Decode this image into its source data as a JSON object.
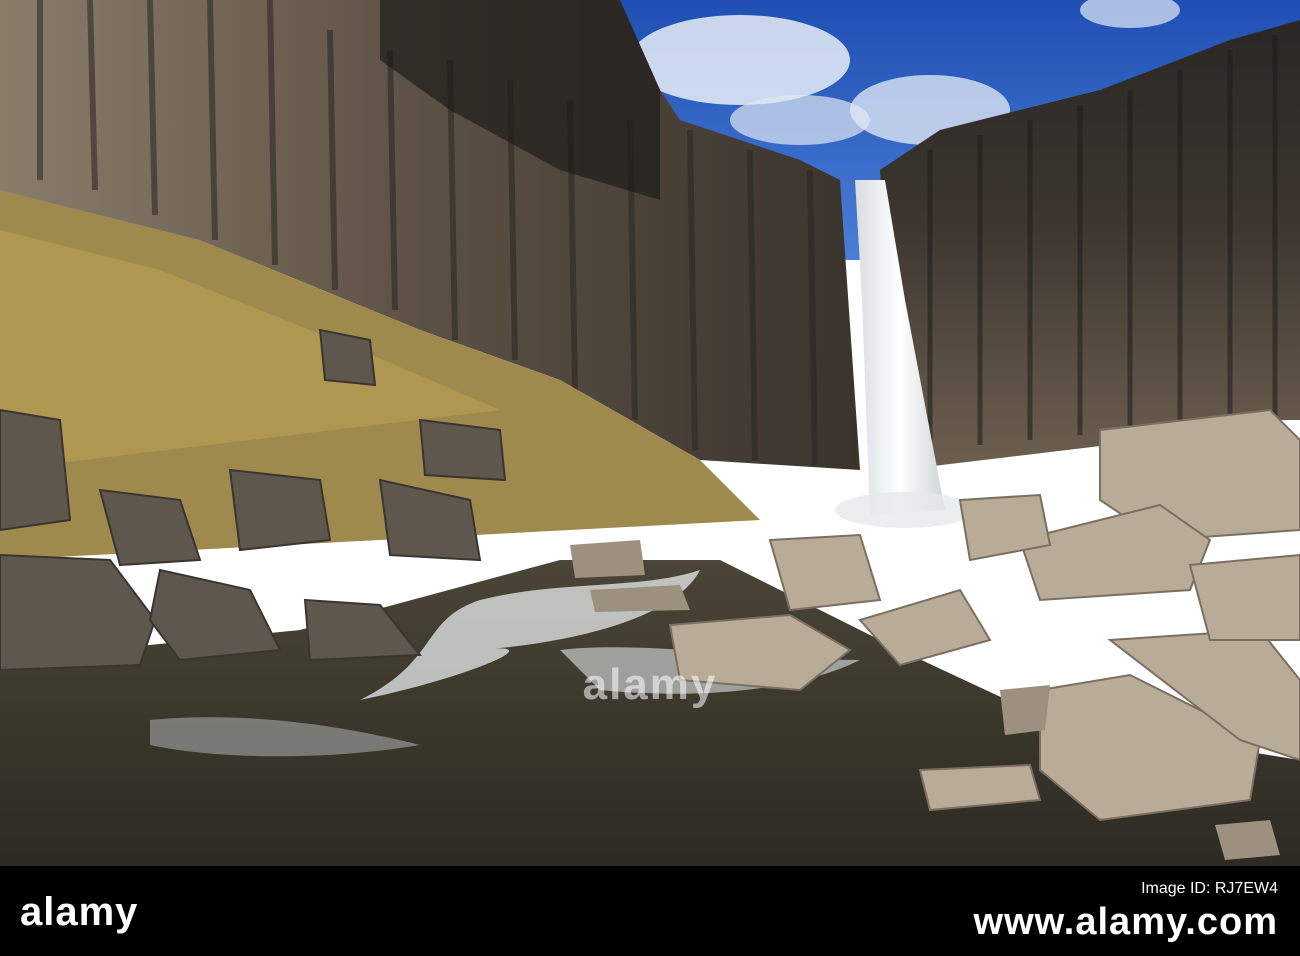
{
  "photo": {
    "subject": "waterfall-over-basalt-columns",
    "colors": {
      "sky": "#2f63c4",
      "cliff_dark": "#2b2824",
      "cliff_light": "#7d6f5f",
      "water": "#3e3a2e",
      "boulder": "#b8ab97",
      "grass": "#b39a54"
    }
  },
  "watermark": {
    "text": "alamy"
  },
  "footer": {
    "logo_text": "alamy",
    "image_id_label": "Image ID: RJ7EW4",
    "site_url": "www.alamy.com"
  }
}
